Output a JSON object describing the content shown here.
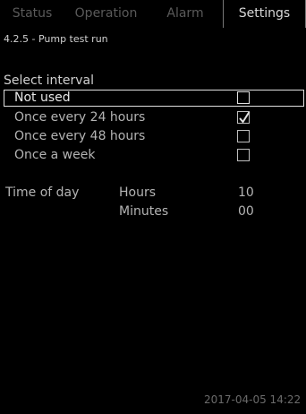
{
  "tabs": [
    {
      "label": "Status",
      "active": false
    },
    {
      "label": "Operation",
      "active": false
    },
    {
      "label": "Alarm",
      "active": false
    },
    {
      "label": "Settings",
      "active": true
    }
  ],
  "breadcrumb": "4.2.5 - Pump test run",
  "section_title": "Select interval",
  "intervals": [
    {
      "label": "Not used",
      "checked": false,
      "selected": true
    },
    {
      "label": "Once every 24 hours",
      "checked": true,
      "selected": false
    },
    {
      "label": "Once every 48 hours",
      "checked": false,
      "selected": false
    },
    {
      "label": "Once a week",
      "checked": false,
      "selected": false
    }
  ],
  "time_of_day": {
    "label": "Time of day",
    "hours_label": "Hours",
    "hours_value": "10",
    "minutes_label": "Minutes",
    "minutes_value": "00"
  },
  "status_datetime": "2017-04-05 14:22",
  "colors": {
    "background": "#000000",
    "text": "#b4b4b4",
    "inactive_tab": "#5a5a5a"
  }
}
